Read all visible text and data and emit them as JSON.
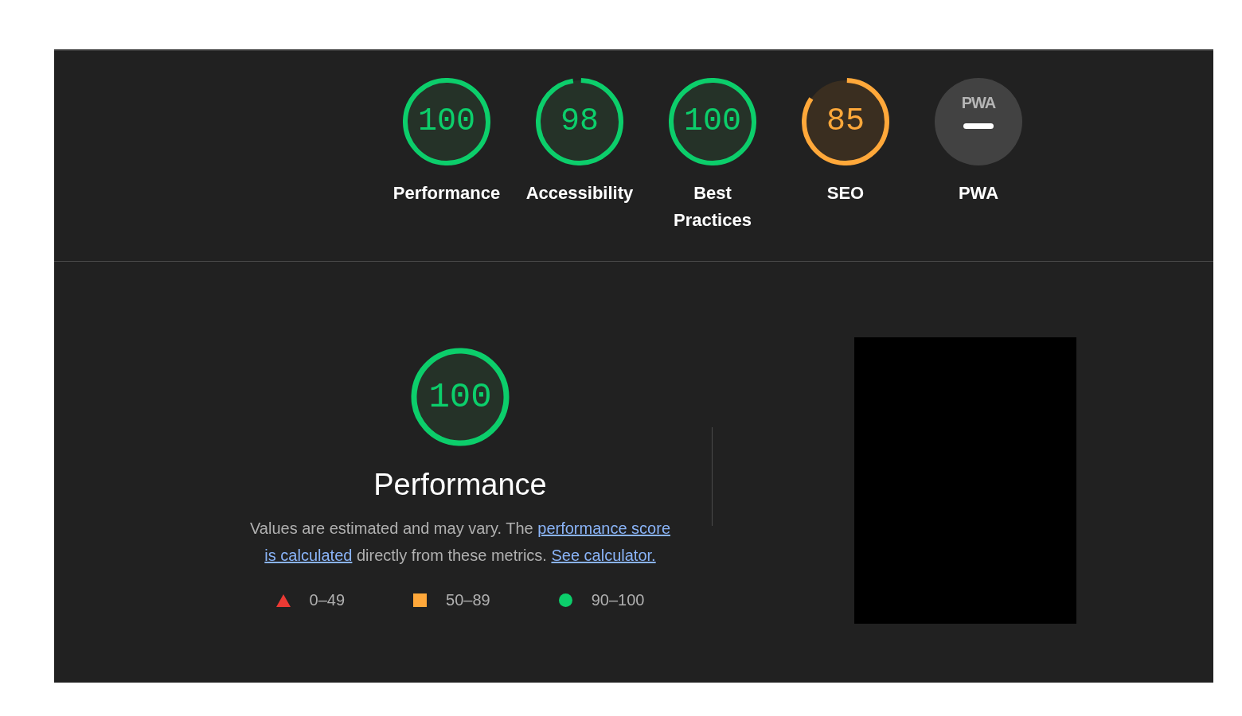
{
  "categories": [
    {
      "kind": "score",
      "score": "100",
      "level": 1.0,
      "label": "Performance"
    },
    {
      "kind": "score",
      "score": "98",
      "level": 0.98,
      "label": "Accessibility"
    },
    {
      "kind": "score",
      "score": "100",
      "level": 1.0,
      "label": "Best Practices"
    },
    {
      "kind": "score",
      "score": "85",
      "level": 0.85,
      "label": "SEO"
    },
    {
      "kind": "pwa",
      "badge_text": "PWA",
      "label": "PWA"
    }
  ],
  "performance": {
    "score": "100",
    "level": 1.0,
    "title": "Performance",
    "description": [
      {
        "kind": "text",
        "text": "Values are estimated and may vary. The "
      },
      {
        "kind": "link",
        "text": "performance score"
      },
      {
        "kind": "break"
      },
      {
        "kind": "link",
        "text": "is calculated"
      },
      {
        "kind": "text",
        "text": " directly from these metrics. "
      },
      {
        "kind": "link",
        "text": "See calculator."
      }
    ],
    "legend": [
      {
        "kind": "triangle",
        "color": "#eb3a34",
        "label": "0–49"
      },
      {
        "kind": "square",
        "color": "#ffa83a",
        "label": "50–89"
      },
      {
        "kind": "circle",
        "color": "#0cce6b",
        "label": "90–100"
      }
    ]
  }
}
